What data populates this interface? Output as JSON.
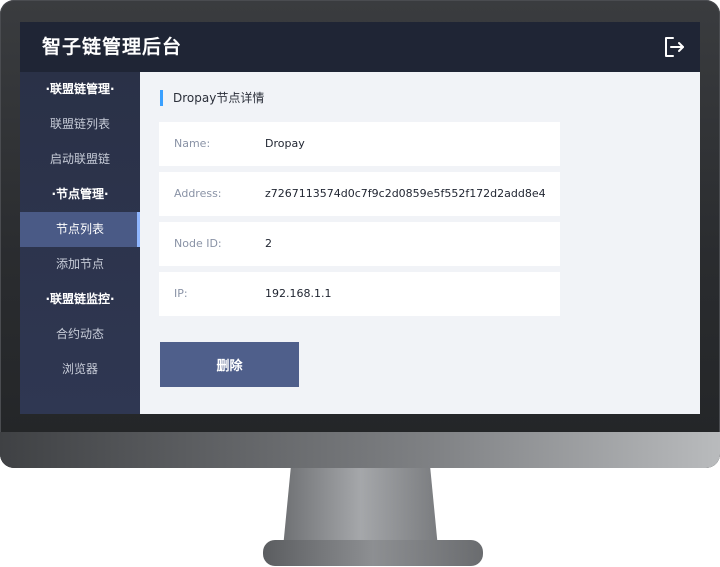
{
  "app": {
    "title": "智子链管理后台",
    "logout_icon": "logout-icon"
  },
  "sidebar": {
    "items": [
      {
        "label": "·联盟链管理·",
        "type": "group"
      },
      {
        "label": "联盟链列表",
        "type": "item"
      },
      {
        "label": "启动联盟链",
        "type": "item"
      },
      {
        "label": "·节点管理·",
        "type": "group"
      },
      {
        "label": "节点列表",
        "type": "item",
        "active": true
      },
      {
        "label": "添加节点",
        "type": "item"
      },
      {
        "label": "·联盟链监控·",
        "type": "group"
      },
      {
        "label": "合约动态",
        "type": "item"
      },
      {
        "label": "浏览器",
        "type": "item"
      }
    ]
  },
  "detail": {
    "section_title": "Dropay节点详情",
    "fields": [
      {
        "label": "Name:",
        "value": "Dropay"
      },
      {
        "label": "Address:",
        "value": "z7267113574d0c7f9c2d0859e5f552f172d2add8e4"
      },
      {
        "label": "Node ID:",
        "value": "2"
      },
      {
        "label": "IP:",
        "value": "192.168.1.1"
      }
    ],
    "delete_label": "删除"
  },
  "colors": {
    "topbar": "#1f2535",
    "sidebar": "#2a3147",
    "active_item": "#4a5a86",
    "accent": "#3aa0ff",
    "button": "#4f5f8b"
  }
}
